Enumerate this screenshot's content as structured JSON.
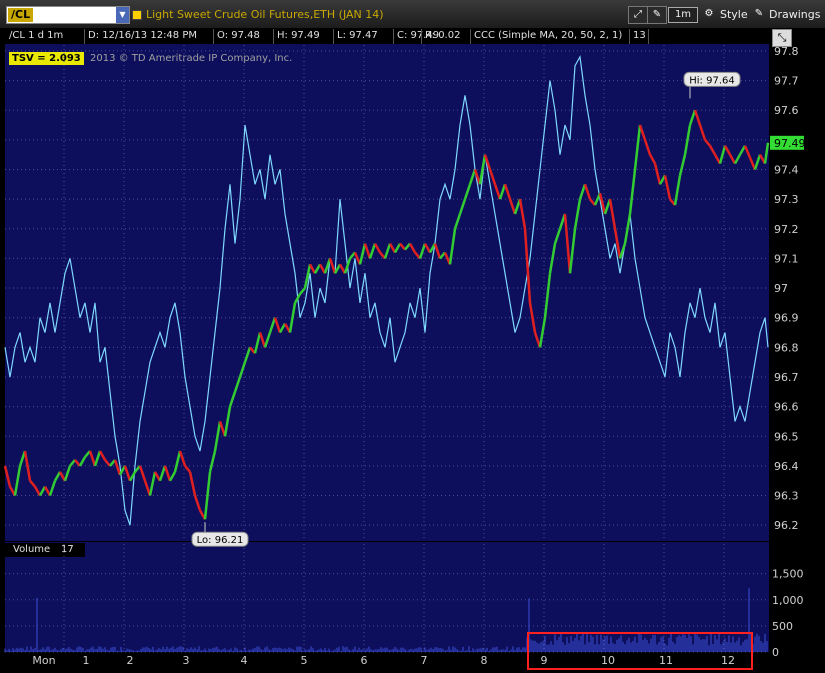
{
  "toolbar": {
    "symbol": "/CL",
    "title": "Light Sweet Crude Oil Futures,ETH (JAN 14)",
    "timeframe_button": "1m",
    "style_label": "Style",
    "drawings_label": "Drawings"
  },
  "info_bar": {
    "symbol_period": "/CL 1 d 1m",
    "date": "D: 12/16/13 12:48 PM",
    "open": "O: 97.48",
    "high": "H: 97.49",
    "low": "L: 97.47",
    "close": "C: 97.49",
    "range": "R: 0.02",
    "study": "CCC (Simple MA, 20, 50, 2, 1)",
    "study_value": "13"
  },
  "tsv_badge": "TSV  = 2.093",
  "copyright": "2013 © TD Ameritrade IP Company, Inc.",
  "volume_panel": {
    "label": "Volume",
    "value": "17"
  },
  "colors": {
    "background": "#0d0f5c",
    "grid": "#4a4f8a",
    "price_up": "#33cc33",
    "price_down": "#e02020",
    "ccc_line": "#7fd8ff",
    "volume_bars": "#3a4fd8",
    "highlight_box": "#ff2020",
    "last_price_tag": "#33dd33"
  },
  "chart_data": {
    "type": "line",
    "price_axis": {
      "ticks": [
        "97.8",
        "97.7",
        "97.6",
        "97.5",
        "97.4",
        "97.3",
        "97.2",
        "97.1",
        "97",
        "96.9",
        "96.8",
        "96.7",
        "96.6",
        "96.5",
        "96.4",
        "96.3",
        "96.2"
      ],
      "range": [
        96.15,
        97.82
      ]
    },
    "volume_axis": {
      "ticks": [
        "1,500",
        "1,000",
        "500",
        "0"
      ],
      "range": [
        0,
        1800
      ]
    },
    "x_ticks": [
      "Mon",
      "1",
      "2",
      "3",
      "4",
      "5",
      "6",
      "7",
      "8",
      "9",
      "10",
      "11",
      "12"
    ],
    "last_price": "97.49",
    "high_label": "Hi: 97.64",
    "low_label": "Lo: 96.21",
    "price_points": [
      [
        0,
        96.4
      ],
      [
        5,
        96.33
      ],
      [
        10,
        96.3
      ],
      [
        15,
        96.4
      ],
      [
        20,
        96.45
      ],
      [
        25,
        96.35
      ],
      [
        30,
        96.33
      ],
      [
        35,
        96.3
      ],
      [
        40,
        96.33
      ],
      [
        45,
        96.3
      ],
      [
        50,
        96.35
      ],
      [
        55,
        96.38
      ],
      [
        60,
        96.35
      ],
      [
        65,
        96.4
      ],
      [
        70,
        96.42
      ],
      [
        75,
        96.4
      ],
      [
        80,
        96.43
      ],
      [
        85,
        96.45
      ],
      [
        90,
        96.4
      ],
      [
        95,
        96.45
      ],
      [
        100,
        96.42
      ],
      [
        105,
        96.4
      ],
      [
        110,
        96.42
      ],
      [
        115,
        96.37
      ],
      [
        120,
        96.4
      ],
      [
        125,
        96.35
      ],
      [
        130,
        96.38
      ],
      [
        135,
        96.4
      ],
      [
        140,
        96.35
      ],
      [
        145,
        96.3
      ],
      [
        150,
        96.38
      ],
      [
        155,
        96.35
      ],
      [
        160,
        96.4
      ],
      [
        165,
        96.35
      ],
      [
        170,
        96.38
      ],
      [
        175,
        96.45
      ],
      [
        180,
        96.4
      ],
      [
        185,
        96.38
      ],
      [
        190,
        96.3
      ],
      [
        195,
        96.25
      ],
      [
        200,
        96.22
      ],
      [
        205,
        96.38
      ],
      [
        210,
        96.45
      ],
      [
        215,
        96.55
      ],
      [
        220,
        96.5
      ],
      [
        225,
        96.6
      ],
      [
        230,
        96.65
      ],
      [
        235,
        96.7
      ],
      [
        240,
        96.75
      ],
      [
        245,
        96.8
      ],
      [
        250,
        96.78
      ],
      [
        255,
        96.85
      ],
      [
        260,
        96.8
      ],
      [
        265,
        96.85
      ],
      [
        270,
        96.9
      ],
      [
        275,
        96.85
      ],
      [
        280,
        96.88
      ],
      [
        285,
        96.85
      ],
      [
        290,
        96.95
      ],
      [
        295,
        96.98
      ],
      [
        300,
        97.0
      ],
      [
        305,
        97.08
      ],
      [
        310,
        97.05
      ],
      [
        315,
        97.08
      ],
      [
        320,
        97.05
      ],
      [
        325,
        97.1
      ],
      [
        330,
        97.05
      ],
      [
        335,
        97.08
      ],
      [
        340,
        97.05
      ],
      [
        345,
        97.1
      ],
      [
        350,
        97.12
      ],
      [
        355,
        97.08
      ],
      [
        360,
        97.15
      ],
      [
        365,
        97.1
      ],
      [
        370,
        97.15
      ],
      [
        375,
        97.12
      ],
      [
        380,
        97.1
      ],
      [
        385,
        97.15
      ],
      [
        390,
        97.12
      ],
      [
        395,
        97.15
      ],
      [
        400,
        97.13
      ],
      [
        405,
        97.15
      ],
      [
        410,
        97.12
      ],
      [
        415,
        97.1
      ],
      [
        420,
        97.15
      ],
      [
        425,
        97.12
      ],
      [
        430,
        97.15
      ],
      [
        435,
        97.1
      ],
      [
        440,
        97.12
      ],
      [
        445,
        97.08
      ],
      [
        450,
        97.2
      ],
      [
        455,
        97.25
      ],
      [
        460,
        97.3
      ],
      [
        465,
        97.35
      ],
      [
        470,
        97.4
      ],
      [
        475,
        97.35
      ],
      [
        480,
        97.45
      ],
      [
        485,
        97.4
      ],
      [
        490,
        97.35
      ],
      [
        495,
        97.3
      ],
      [
        500,
        97.35
      ],
      [
        505,
        97.3
      ],
      [
        510,
        97.25
      ],
      [
        515,
        97.3
      ],
      [
        520,
        97.2
      ],
      [
        525,
        96.95
      ],
      [
        530,
        96.85
      ],
      [
        535,
        96.8
      ],
      [
        540,
        96.9
      ],
      [
        545,
        97.05
      ],
      [
        550,
        97.15
      ],
      [
        555,
        97.2
      ],
      [
        560,
        97.25
      ],
      [
        565,
        97.05
      ],
      [
        570,
        97.2
      ],
      [
        575,
        97.3
      ],
      [
        580,
        97.35
      ],
      [
        585,
        97.3
      ],
      [
        590,
        97.28
      ],
      [
        595,
        97.32
      ],
      [
        600,
        97.25
      ],
      [
        605,
        97.3
      ],
      [
        610,
        97.2
      ],
      [
        615,
        97.1
      ],
      [
        620,
        97.15
      ],
      [
        625,
        97.25
      ],
      [
        630,
        97.4
      ],
      [
        635,
        97.55
      ],
      [
        640,
        97.5
      ],
      [
        645,
        97.45
      ],
      [
        650,
        97.42
      ],
      [
        655,
        97.35
      ],
      [
        660,
        97.38
      ],
      [
        665,
        97.3
      ],
      [
        670,
        97.28
      ],
      [
        675,
        97.38
      ],
      [
        680,
        97.45
      ],
      [
        685,
        97.55
      ],
      [
        690,
        97.6
      ],
      [
        695,
        97.55
      ],
      [
        700,
        97.5
      ],
      [
        705,
        97.48
      ],
      [
        710,
        97.45
      ],
      [
        715,
        97.42
      ],
      [
        720,
        97.48
      ],
      [
        725,
        97.45
      ],
      [
        730,
        97.42
      ],
      [
        735,
        97.45
      ],
      [
        740,
        97.48
      ],
      [
        745,
        97.44
      ],
      [
        750,
        97.4
      ],
      [
        755,
        97.45
      ],
      [
        760,
        97.42
      ],
      [
        763,
        97.49
      ]
    ],
    "ccc_points": [
      [
        0,
        96.8
      ],
      [
        5,
        96.7
      ],
      [
        10,
        96.8
      ],
      [
        15,
        96.85
      ],
      [
        20,
        96.75
      ],
      [
        25,
        96.8
      ],
      [
        30,
        96.75
      ],
      [
        35,
        96.9
      ],
      [
        40,
        96.85
      ],
      [
        45,
        96.95
      ],
      [
        50,
        96.85
      ],
      [
        55,
        96.95
      ],
      [
        60,
        97.05
      ],
      [
        65,
        97.1
      ],
      [
        70,
        97.0
      ],
      [
        75,
        96.9
      ],
      [
        80,
        96.95
      ],
      [
        85,
        96.85
      ],
      [
        90,
        96.95
      ],
      [
        95,
        96.75
      ],
      [
        100,
        96.8
      ],
      [
        105,
        96.65
      ],
      [
        110,
        96.5
      ],
      [
        115,
        96.4
      ],
      [
        120,
        96.25
      ],
      [
        125,
        96.2
      ],
      [
        130,
        96.4
      ],
      [
        135,
        96.55
      ],
      [
        140,
        96.65
      ],
      [
        145,
        96.75
      ],
      [
        150,
        96.8
      ],
      [
        155,
        96.85
      ],
      [
        160,
        96.8
      ],
      [
        165,
        96.9
      ],
      [
        170,
        96.95
      ],
      [
        175,
        96.85
      ],
      [
        180,
        96.7
      ],
      [
        185,
        96.6
      ],
      [
        190,
        96.5
      ],
      [
        195,
        96.45
      ],
      [
        200,
        96.55
      ],
      [
        205,
        96.7
      ],
      [
        210,
        96.85
      ],
      [
        215,
        97.0
      ],
      [
        220,
        97.2
      ],
      [
        225,
        97.35
      ],
      [
        230,
        97.15
      ],
      [
        235,
        97.3
      ],
      [
        240,
        97.55
      ],
      [
        245,
        97.45
      ],
      [
        250,
        97.35
      ],
      [
        255,
        97.4
      ],
      [
        260,
        97.3
      ],
      [
        265,
        97.45
      ],
      [
        270,
        97.35
      ],
      [
        275,
        97.4
      ],
      [
        280,
        97.25
      ],
      [
        285,
        97.15
      ],
      [
        290,
        97.05
      ],
      [
        295,
        96.9
      ],
      [
        300,
        96.95
      ],
      [
        305,
        97.05
      ],
      [
        310,
        96.9
      ],
      [
        315,
        97.0
      ],
      [
        320,
        96.95
      ],
      [
        325,
        97.1
      ],
      [
        330,
        97.05
      ],
      [
        335,
        97.3
      ],
      [
        340,
        97.15
      ],
      [
        345,
        97.0
      ],
      [
        350,
        97.1
      ],
      [
        355,
        96.95
      ],
      [
        360,
        97.05
      ],
      [
        365,
        96.9
      ],
      [
        370,
        96.95
      ],
      [
        375,
        96.85
      ],
      [
        380,
        96.8
      ],
      [
        385,
        96.9
      ],
      [
        390,
        96.75
      ],
      [
        395,
        96.8
      ],
      [
        400,
        96.85
      ],
      [
        405,
        96.95
      ],
      [
        410,
        96.9
      ],
      [
        415,
        97.0
      ],
      [
        420,
        96.85
      ],
      [
        425,
        97.05
      ],
      [
        430,
        97.15
      ],
      [
        435,
        97.3
      ],
      [
        440,
        97.35
      ],
      [
        445,
        97.3
      ],
      [
        450,
        97.4
      ],
      [
        455,
        97.55
      ],
      [
        460,
        97.65
      ],
      [
        465,
        97.55
      ],
      [
        470,
        97.4
      ],
      [
        475,
        97.3
      ],
      [
        480,
        97.45
      ],
      [
        485,
        97.35
      ],
      [
        490,
        97.25
      ],
      [
        495,
        97.15
      ],
      [
        500,
        97.05
      ],
      [
        505,
        96.95
      ],
      [
        510,
        96.85
      ],
      [
        515,
        96.9
      ],
      [
        520,
        97.0
      ],
      [
        525,
        97.1
      ],
      [
        530,
        97.25
      ],
      [
        535,
        97.4
      ],
      [
        540,
        97.55
      ],
      [
        545,
        97.7
      ],
      [
        550,
        97.6
      ],
      [
        555,
        97.45
      ],
      [
        560,
        97.55
      ],
      [
        565,
        97.5
      ],
      [
        570,
        97.75
      ],
      [
        575,
        97.78
      ],
      [
        580,
        97.65
      ],
      [
        585,
        97.55
      ],
      [
        590,
        97.4
      ],
      [
        595,
        97.3
      ],
      [
        600,
        97.2
      ],
      [
        605,
        97.1
      ],
      [
        610,
        97.15
      ],
      [
        615,
        97.05
      ],
      [
        620,
        97.15
      ],
      [
        625,
        97.25
      ],
      [
        630,
        97.1
      ],
      [
        635,
        97.0
      ],
      [
        640,
        96.9
      ],
      [
        645,
        96.85
      ],
      [
        650,
        96.8
      ],
      [
        655,
        96.75
      ],
      [
        660,
        96.7
      ],
      [
        665,
        96.85
      ],
      [
        670,
        96.8
      ],
      [
        675,
        96.7
      ],
      [
        680,
        96.85
      ],
      [
        685,
        96.95
      ],
      [
        690,
        96.9
      ],
      [
        695,
        97.0
      ],
      [
        700,
        96.9
      ],
      [
        705,
        96.85
      ],
      [
        710,
        96.95
      ],
      [
        715,
        96.8
      ],
      [
        720,
        96.85
      ],
      [
        725,
        96.7
      ],
      [
        730,
        96.55
      ],
      [
        735,
        96.6
      ],
      [
        740,
        96.55
      ],
      [
        745,
        96.65
      ],
      [
        750,
        96.75
      ],
      [
        755,
        96.85
      ],
      [
        760,
        96.9
      ],
      [
        763,
        96.8
      ]
    ]
  }
}
